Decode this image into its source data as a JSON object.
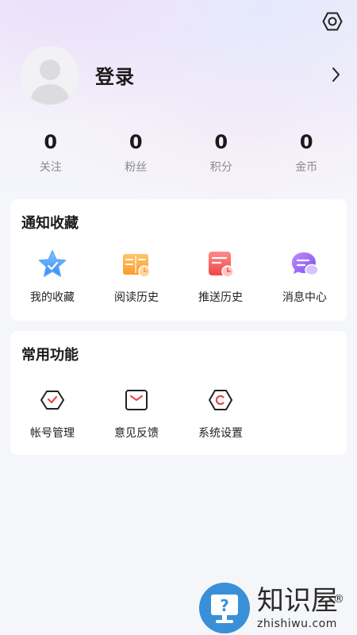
{
  "profile": {
    "login_label": "登录"
  },
  "stats": [
    {
      "value": "0",
      "label": "关注"
    },
    {
      "value": "0",
      "label": "粉丝"
    },
    {
      "value": "0",
      "label": "积分"
    },
    {
      "value": "0",
      "label": "金币"
    }
  ],
  "notify_section": {
    "title": "通知收藏",
    "items": [
      {
        "label": "我的收藏",
        "icon": "star-icon"
      },
      {
        "label": "阅读历史",
        "icon": "book-history-icon"
      },
      {
        "label": "推送历史",
        "icon": "push-history-icon"
      },
      {
        "label": "消息中心",
        "icon": "message-icon"
      }
    ]
  },
  "common_section": {
    "title": "常用功能",
    "items": [
      {
        "label": "帐号管理",
        "icon": "account-icon"
      },
      {
        "label": "意见反馈",
        "icon": "feedback-icon"
      },
      {
        "label": "系统设置",
        "icon": "settings-icon"
      }
    ]
  },
  "watermark": {
    "name": "知识屋",
    "domain": "zhishiwu.com",
    "mark": "®"
  },
  "colors": {
    "accent": "#e5484d",
    "background": "#f5f6fa"
  }
}
